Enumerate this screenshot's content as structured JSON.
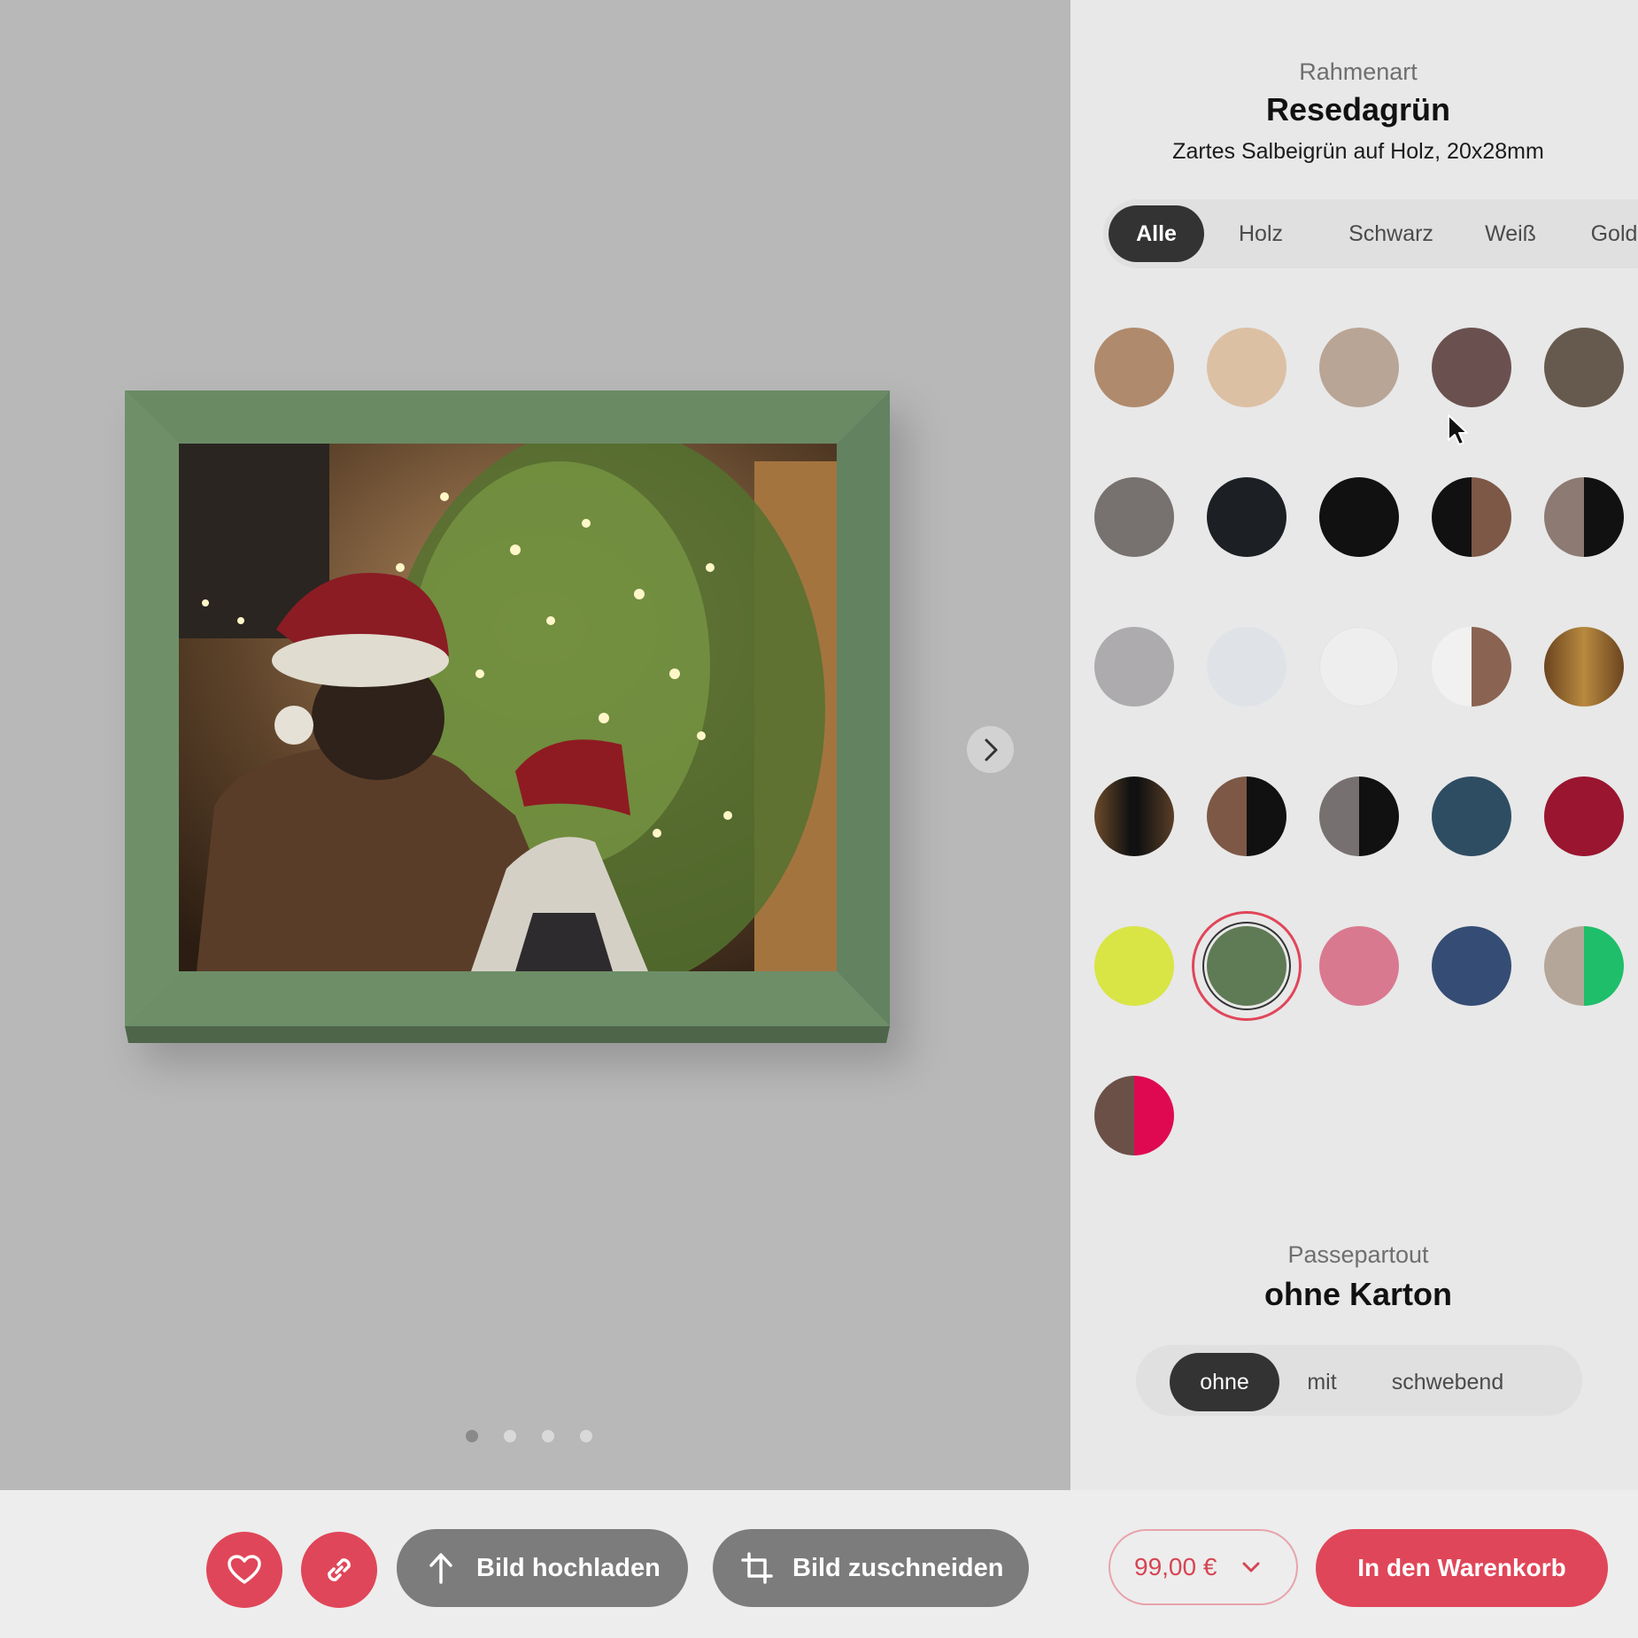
{
  "frame_type": {
    "label": "Rahmenart",
    "title": "Resedagrün",
    "description": "Zartes Salbeigrün auf Holz, 20x28mm",
    "color": "#6c8d67"
  },
  "filters": [
    "Alle",
    "Holz",
    "Schwarz",
    "Weiß",
    "Gold"
  ],
  "active_filter": "Alle",
  "swatches": [
    {
      "name": "swatch-natural-oak",
      "fill": "#b08a6c"
    },
    {
      "name": "swatch-light-oak",
      "fill": "#dcc0a4"
    },
    {
      "name": "swatch-greige-wood",
      "fill": "#b9a596"
    },
    {
      "name": "swatch-walnut",
      "fill": "#6a5150"
    },
    {
      "name": "swatch-dark-oak",
      "fill": "#665a4e"
    },
    {
      "name": "swatch-grey-wood",
      "fill": "#77726f"
    },
    {
      "name": "swatch-black-wood",
      "fill": "#1c1f23"
    },
    {
      "name": "swatch-black",
      "fill": "#111111"
    },
    {
      "name": "swatch-black-walnut",
      "fill": "linear-gradient(90deg,#111 50%,#7d5846 50%)"
    },
    {
      "name": "swatch-grey-black",
      "fill": "linear-gradient(90deg,#8c7a73 50%,#111 50%)"
    },
    {
      "name": "swatch-light-grey",
      "fill": "#adabae"
    },
    {
      "name": "swatch-white-wood",
      "fill": "#dfe3e7"
    },
    {
      "name": "swatch-white",
      "fill": "#eeeeee"
    },
    {
      "name": "swatch-white-walnut",
      "fill": "linear-gradient(90deg,#f1f1f1 50%,#8b6352 50%)"
    },
    {
      "name": "swatch-gold-wood",
      "fill": "linear-gradient(90deg,#6b4420,#b88a3e,#6b4420)"
    },
    {
      "name": "swatch-black-gold",
      "fill": "linear-gradient(90deg,#6b4b2b,#111 45%,#111 55%,#5a3e27)"
    },
    {
      "name": "swatch-walnut-black",
      "fill": "linear-gradient(90deg,#7d5846 50%,#111 50%)"
    },
    {
      "name": "swatch-grey-black-split",
      "fill": "linear-gradient(90deg,#767170 50%,#111 50%)"
    },
    {
      "name": "swatch-petrol",
      "fill": "#2e4d63"
    },
    {
      "name": "swatch-red",
      "fill": "#9a1530"
    },
    {
      "name": "swatch-neon-yellow",
      "fill": "#d8e545"
    },
    {
      "name": "swatch-reseda-green",
      "fill": "#5f7b55",
      "selected": true
    },
    {
      "name": "swatch-pink",
      "fill": "#d97990"
    },
    {
      "name": "swatch-navy",
      "fill": "#354d74"
    },
    {
      "name": "swatch-grey-green",
      "fill": "linear-gradient(90deg,#b5a69a 50%,#1fbe6a 50%)"
    },
    {
      "name": "swatch-walnut-magenta",
      "fill": "linear-gradient(90deg,#6b5048 50%,#df0952 50%)"
    }
  ],
  "passepartout": {
    "label": "Passepartout",
    "title": "ohne Karton",
    "options": [
      "ohne",
      "mit",
      "schwebend"
    ],
    "active": "ohne"
  },
  "carousel": {
    "count": 4,
    "active_index": 0
  },
  "toolbar": {
    "upload_label": "Bild hochladen",
    "crop_label": "Bild zuschneiden",
    "price": "99,00 €",
    "cart_label": "In den Warenkorb"
  },
  "colors": {
    "accent": "#e04659",
    "dark": "#333333",
    "button_grey": "#7c7c7c"
  },
  "icons": [
    "heart-icon",
    "link-icon",
    "upload-arrow-icon",
    "crop-icon",
    "chevron-down-icon",
    "chevron-right-icon"
  ]
}
